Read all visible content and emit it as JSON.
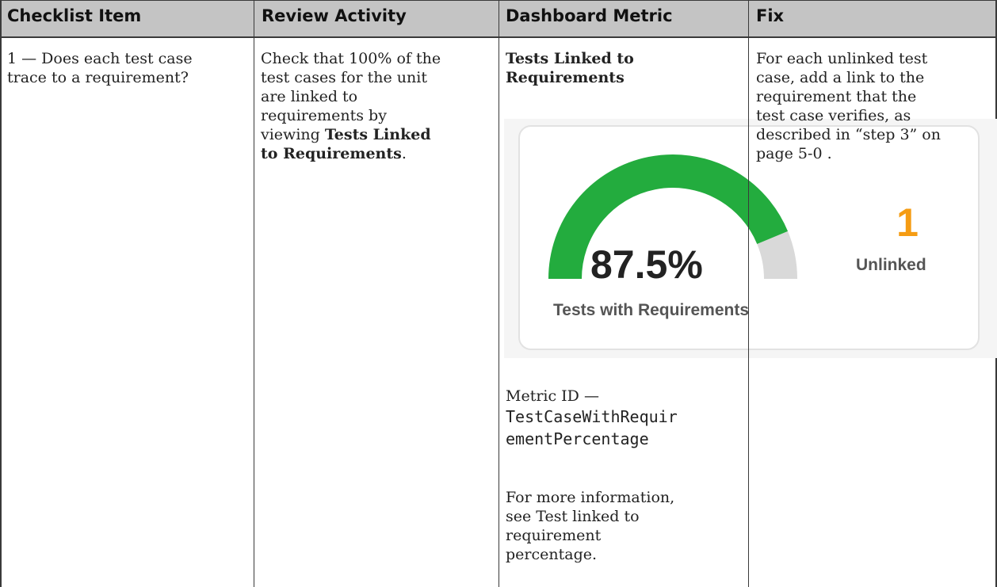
{
  "headers": {
    "checklist_item": "Checklist Item",
    "review_activity": "Review Activity",
    "dashboard_metric": "Dashboard Metric",
    "fix": "Fix"
  },
  "row": {
    "checklist_line1": "1 — Does each test case",
    "checklist_line2": "trace to a requirement?",
    "review_line1": "Check that 100% of the",
    "review_line2": "test cases for the unit",
    "review_line3": "are linked to",
    "review_line4": "requirements by",
    "review_line5_text": "viewing ",
    "review_line5_bold": "Tests Linked",
    "review_line6_bold": "to Requirements",
    "review_line6_end": ".",
    "metric_title_line1": "Tests Linked to",
    "metric_title_line2": "Requirements",
    "metric_id_label": "Metric ID —",
    "metric_id_line1": "TestCaseWithRequir",
    "metric_id_line2": "ementPercentage",
    "more_info_line1": "For more information,",
    "more_info_line2": "see Test linked to",
    "more_info_line3": "requirement",
    "more_info_line4": "percentage.",
    "fix_line1": "For each unlinked test",
    "fix_line2": "case, add a link to the",
    "fix_line3": "requirement that the",
    "fix_line4": "test case verifies, as",
    "fix_line5": "described in “step 3” on",
    "fix_line6": "page 5-0    ."
  },
  "widget": {
    "gauge_value": "87.5%",
    "gauge_fraction": 0.875,
    "gauge_caption": "Tests with Requirements",
    "unlinked_count": "1",
    "unlinked_label": "Unlinked",
    "colors": {
      "gauge_fill": "#23ac3e",
      "gauge_track": "#d9d9d9",
      "unlinked_number": "#f59c13",
      "header_bg": "#c4c4c4"
    }
  }
}
